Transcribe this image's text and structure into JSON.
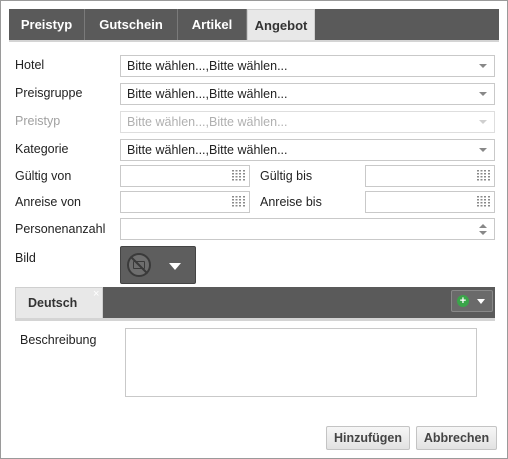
{
  "tabs": [
    "Preistyp",
    "Gutschein",
    "Artikel",
    "Angebot"
  ],
  "active_tab": "Angebot",
  "form": {
    "hotel_label": "Hotel",
    "hotel_value": "Bitte wählen...,Bitte wählen...",
    "preisgruppe_label": "Preisgruppe",
    "preisgruppe_value": "Bitte wählen...,Bitte wählen...",
    "preistyp_label": "Preistyp",
    "preistyp_value": "Bitte wählen...,Bitte wählen...",
    "kategorie_label": "Kategorie",
    "kategorie_value": "Bitte wählen...,Bitte wählen...",
    "gueltig_von_label": "Gültig von",
    "gueltig_bis_label": "Gültig bis",
    "anreise_von_label": "Anreise von",
    "anreise_bis_label": "Anreise bis",
    "personenanzahl_label": "Personenanzahl",
    "bild_label": "Bild"
  },
  "language_tab": {
    "label": "Deutsch",
    "close": "×"
  },
  "beschreibung_label": "Beschreibung",
  "buttons": {
    "add": "Hinzufügen",
    "cancel": "Abbrechen"
  },
  "colors": {
    "tabbar": "#5a5a5a",
    "active_tab": "#e8e8e8",
    "add_icon": "#3aa54a"
  },
  "icons": [
    "calendar-icon",
    "no-image-icon",
    "dropdown-caret-icon",
    "add-icon",
    "spinner-icon"
  ]
}
